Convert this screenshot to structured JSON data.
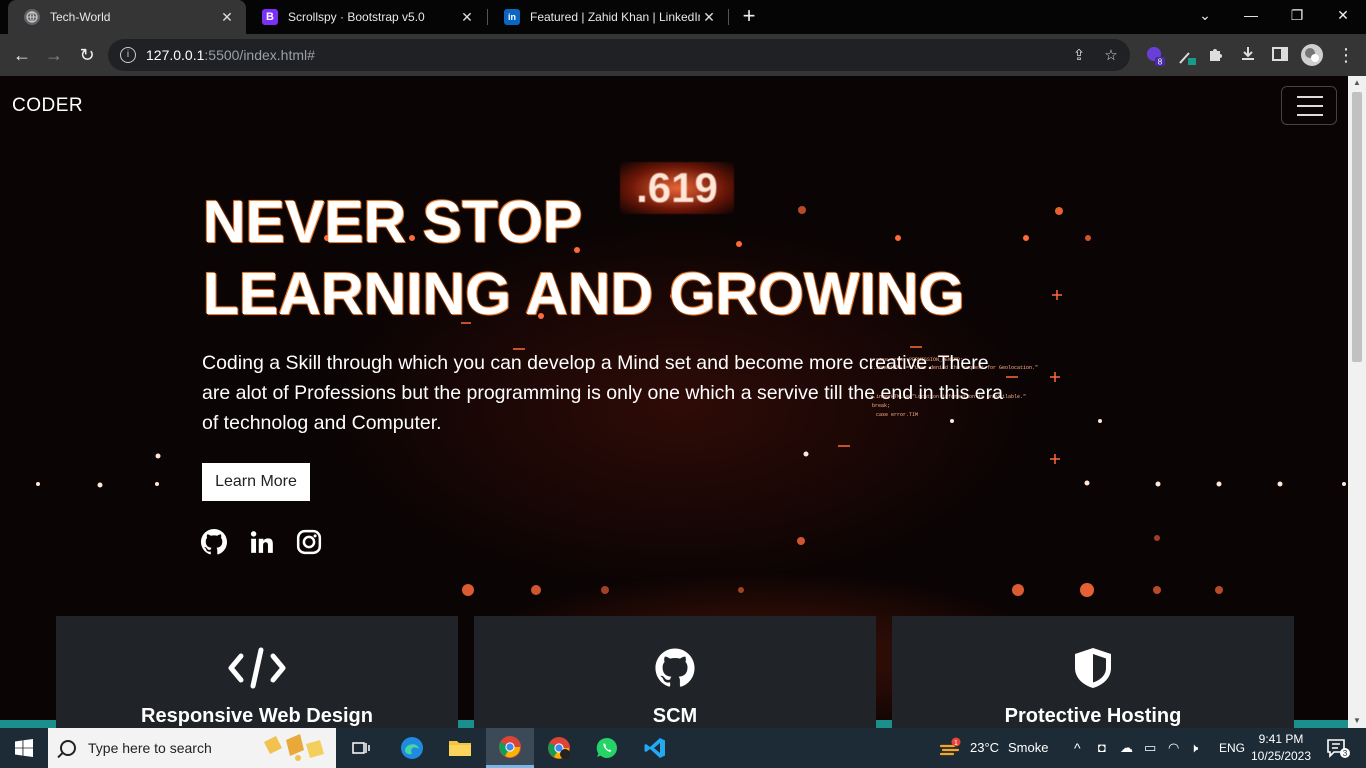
{
  "browser": {
    "tabs": [
      {
        "title": "Tech-World",
        "active": true
      },
      {
        "title": "Scrollspy · Bootstrap v5.0",
        "active": false
      },
      {
        "title": "Featured | Zahid Khan | LinkedIn",
        "active": false
      }
    ],
    "new_tab": "+",
    "url_host": "127.0.0.1",
    "url_rest": ":5500/index.html#",
    "extension_badge": "8"
  },
  "navbar": {
    "brand": "CODER"
  },
  "hero": {
    "counter": ".619",
    "title_line1": "NEVER STOP",
    "title_line2": "LEARNING AND GROWING",
    "description": "Coding a Skill through which you can develop a Mind set and become more creative. There are alot of Professions but the programming is only one which a servive till the end in this era of technolog and Computer.",
    "button": "Learn More",
    "social": [
      "github-icon",
      "linkedin-icon",
      "instagram-icon"
    ]
  },
  "cards": [
    {
      "icon": "code-icon",
      "title": "Responsive Web Design"
    },
    {
      "icon": "github-icon",
      "title": "SCM"
    },
    {
      "icon": "shield-icon",
      "title": "Protective Hosting"
    }
  ],
  "taskbar": {
    "search_placeholder": "Type here to search",
    "weather_temp": "23°C",
    "weather_desc": "Smoke",
    "weather_badge": "1",
    "language": "ENG",
    "time": "9:41 PM",
    "date": "10/25/2023",
    "notifications": "3"
  },
  "colors": {
    "accent_teal": "#1a8f8c",
    "card_bg": "#202428",
    "hero_glow": "#ff5a2a"
  }
}
